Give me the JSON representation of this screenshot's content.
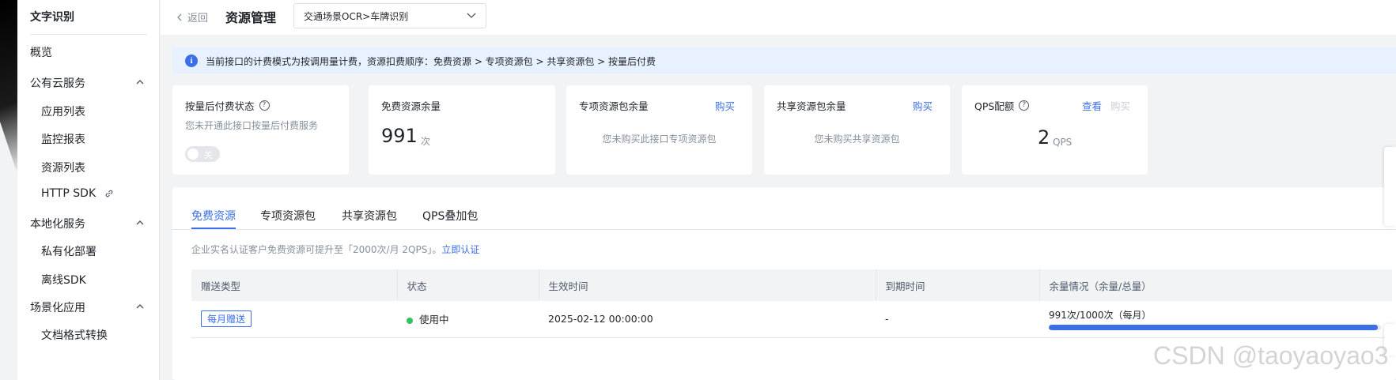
{
  "sidebar": {
    "title": "文字识别",
    "items": [
      {
        "label": "概览"
      },
      {
        "label": "公有云服务"
      },
      {
        "label": "应用列表"
      },
      {
        "label": "监控报表"
      },
      {
        "label": "资源列表"
      },
      {
        "label": "HTTP SDK"
      },
      {
        "label": "本地化服务"
      },
      {
        "label": "私有化部署"
      },
      {
        "label": "离线SDK"
      },
      {
        "label": "场景化应用"
      },
      {
        "label": "文档格式转换"
      }
    ]
  },
  "header": {
    "back_label": "返回",
    "title": "资源管理",
    "select_value": "交通场景OCR>车牌识别"
  },
  "banner": {
    "text": "当前接口的计费模式为按调用量计费，资源扣费顺序：免费资源 > 专项资源包 > 共享资源包 > 按量后付费"
  },
  "cards": {
    "postpaid": {
      "title": "按量后付费状态",
      "desc": "您未开通此接口按量后付费服务",
      "toggle_label": "关"
    },
    "free": {
      "title": "免费资源余量",
      "value": "991",
      "unit": "次"
    },
    "dedicated": {
      "title": "专项资源包余量",
      "action": "购买",
      "empty": "您未购买此接口专项资源包"
    },
    "shared": {
      "title": "共享资源包余量",
      "action": "购买",
      "empty": "您未购买共享资源包"
    },
    "qps": {
      "title": "QPS配额",
      "view": "查看",
      "buy": "购买",
      "value": "2",
      "unit": "QPS"
    }
  },
  "tabs": [
    {
      "label": "免费资源",
      "active": true
    },
    {
      "label": "专项资源包"
    },
    {
      "label": "共享资源包"
    },
    {
      "label": "QPS叠加包"
    }
  ],
  "tip": {
    "text": "企业实名认证客户免费资源可提升至「2000次/月 2QPS」。",
    "link": "立即认证"
  },
  "table": {
    "headers": [
      "赠送类型",
      "状态",
      "生效时间",
      "到期时间",
      "余量情况（余量/总量）"
    ],
    "rows": [
      {
        "type": "每月赠送",
        "status": "使用中",
        "start": "2025-02-12 00:00:00",
        "end": "-",
        "usage_text": "991次/1000次（每月）",
        "usage_fraction": 0.991
      }
    ]
  },
  "watermark": "CSDN @taoyaoyao3",
  "colors": {
    "accent": "#3b6fe8",
    "success": "#33c25f"
  }
}
